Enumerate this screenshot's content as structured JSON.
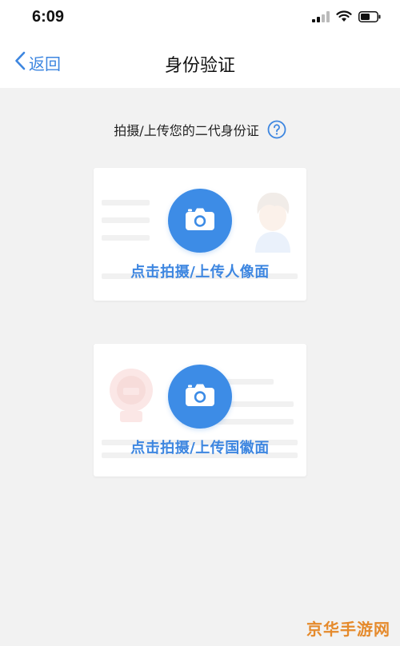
{
  "status_bar": {
    "time": "6:09",
    "icons": [
      "signal-icon",
      "wifi-icon",
      "battery-icon"
    ]
  },
  "nav": {
    "back_label": "返回",
    "title": "身份验证"
  },
  "instruction": {
    "text": "拍摄/上传您的二代身份证",
    "help_icon": "question-icon"
  },
  "cards": {
    "front": {
      "label": "点击拍摄/上传人像面",
      "icon": "camera-icon",
      "illustration": "portrait-avatar-icon"
    },
    "back": {
      "label": "点击拍摄/上传国徽面",
      "icon": "camera-icon",
      "illustration": "national-emblem-icon"
    }
  },
  "watermark": {
    "text": "京华手游网"
  },
  "colors": {
    "accent": "#3d86e0",
    "camera_bg": "#3d8ce6",
    "page_bg": "#f2f2f2",
    "watermark": "#e58a2c"
  }
}
